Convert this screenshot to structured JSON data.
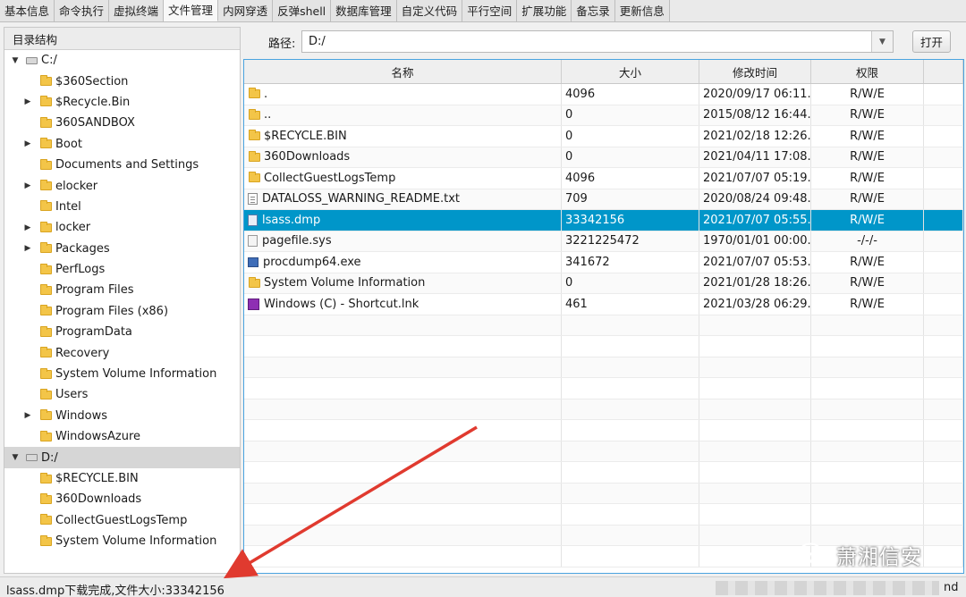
{
  "tabs": [
    {
      "label": "基本信息",
      "active": false
    },
    {
      "label": "命令执行",
      "active": false
    },
    {
      "label": "虚拟终端",
      "active": false
    },
    {
      "label": "文件管理",
      "active": true
    },
    {
      "label": "内网穿透",
      "active": false
    },
    {
      "label": "反弹shell",
      "active": false
    },
    {
      "label": "数据库管理",
      "active": false
    },
    {
      "label": "自定义代码",
      "active": false
    },
    {
      "label": "平行空间",
      "active": false
    },
    {
      "label": "扩展功能",
      "active": false
    },
    {
      "label": "备忘录",
      "active": false
    },
    {
      "label": "更新信息",
      "active": false
    }
  ],
  "tree": {
    "header": "目录结构",
    "nodes": [
      {
        "label": "C:/",
        "type": "drive",
        "level": 0,
        "twisty": "expanded",
        "selected": false
      },
      {
        "label": "$360Section",
        "type": "folder",
        "level": 1,
        "twisty": "none"
      },
      {
        "label": "$Recycle.Bin",
        "type": "folder",
        "level": 1,
        "twisty": "collapsed"
      },
      {
        "label": "360SANDBOX",
        "type": "folder",
        "level": 1,
        "twisty": "none"
      },
      {
        "label": "Boot",
        "type": "folder",
        "level": 1,
        "twisty": "collapsed"
      },
      {
        "label": "Documents and Settings",
        "type": "folder",
        "level": 1,
        "twisty": "none"
      },
      {
        "label": "elocker",
        "type": "folder",
        "level": 1,
        "twisty": "collapsed"
      },
      {
        "label": "Intel",
        "type": "folder",
        "level": 1,
        "twisty": "none"
      },
      {
        "label": "locker",
        "type": "folder",
        "level": 1,
        "twisty": "collapsed"
      },
      {
        "label": "Packages",
        "type": "folder",
        "level": 1,
        "twisty": "collapsed"
      },
      {
        "label": "PerfLogs",
        "type": "folder",
        "level": 1,
        "twisty": "none"
      },
      {
        "label": "Program Files",
        "type": "folder",
        "level": 1,
        "twisty": "none"
      },
      {
        "label": "Program Files (x86)",
        "type": "folder",
        "level": 1,
        "twisty": "none"
      },
      {
        "label": "ProgramData",
        "type": "folder",
        "level": 1,
        "twisty": "none"
      },
      {
        "label": "Recovery",
        "type": "folder",
        "level": 1,
        "twisty": "none"
      },
      {
        "label": "System Volume Information",
        "type": "folder",
        "level": 1,
        "twisty": "none"
      },
      {
        "label": "Users",
        "type": "folder",
        "level": 1,
        "twisty": "none"
      },
      {
        "label": "Windows",
        "type": "folder",
        "level": 1,
        "twisty": "collapsed"
      },
      {
        "label": "WindowsAzure",
        "type": "folder",
        "level": 1,
        "twisty": "none"
      },
      {
        "label": "D:/",
        "type": "drive",
        "level": 0,
        "twisty": "expanded",
        "selected": true
      },
      {
        "label": "$RECYCLE.BIN",
        "type": "folder",
        "level": 1,
        "twisty": "none"
      },
      {
        "label": "360Downloads",
        "type": "folder",
        "level": 1,
        "twisty": "none"
      },
      {
        "label": "CollectGuestLogsTemp",
        "type": "folder",
        "level": 1,
        "twisty": "none"
      },
      {
        "label": "System Volume Information",
        "type": "folder",
        "level": 1,
        "twisty": "none"
      }
    ]
  },
  "pathbar": {
    "label": "路径:",
    "value": "D:/",
    "open_label": "打开"
  },
  "table": {
    "columns": [
      "名称",
      "大小",
      "修改时间",
      "权限"
    ],
    "rows": [
      {
        "name": ".",
        "size": "4096",
        "time": "2020/09/17 06:11...",
        "perm": "R/W/E",
        "icon": "folder",
        "selected": false
      },
      {
        "name": "..",
        "size": "0",
        "time": "2015/08/12 16:44...",
        "perm": "R/W/E",
        "icon": "folder",
        "selected": false
      },
      {
        "name": "$RECYCLE.BIN",
        "size": "0",
        "time": "2021/02/18 12:26...",
        "perm": "R/W/E",
        "icon": "folder",
        "selected": false
      },
      {
        "name": "360Downloads",
        "size": "0",
        "time": "2021/04/11 17:08...",
        "perm": "R/W/E",
        "icon": "folder",
        "selected": false
      },
      {
        "name": "CollectGuestLogsTemp",
        "size": "4096",
        "time": "2021/07/07 05:19...",
        "perm": "R/W/E",
        "icon": "folder",
        "selected": false
      },
      {
        "name": "DATALOSS_WARNING_README.txt",
        "size": "709",
        "time": "2020/08/24 09:48...",
        "perm": "R/W/E",
        "icon": "txt",
        "selected": false
      },
      {
        "name": "lsass.dmp",
        "size": "33342156",
        "time": "2021/07/07 05:55...",
        "perm": "R/W/E",
        "icon": "dmp",
        "selected": true
      },
      {
        "name": "pagefile.sys",
        "size": "3221225472",
        "time": "1970/01/01 00:00...",
        "perm": "-/-/-",
        "icon": "sys",
        "selected": false
      },
      {
        "name": "procdump64.exe",
        "size": "341672",
        "time": "2021/07/07 05:53...",
        "perm": "R/W/E",
        "icon": "exe",
        "selected": false
      },
      {
        "name": "System Volume Information",
        "size": "0",
        "time": "2021/01/28 18:26...",
        "perm": "R/W/E",
        "icon": "folder",
        "selected": false
      },
      {
        "name": "Windows (C) - Shortcut.lnk",
        "size": "461",
        "time": "2021/03/28 06:29...",
        "perm": "R/W/E",
        "icon": "lnk",
        "selected": false
      }
    ],
    "empty_rows": 12
  },
  "status": {
    "message": "lsass.dmp下载完成,文件大小:33342156",
    "right_text": "nd"
  },
  "watermark": {
    "text": "萧湘信安"
  },
  "colors": {
    "selection": "#0096c9",
    "arrow": "#e03a2f",
    "table_border": "#4aa3df"
  }
}
